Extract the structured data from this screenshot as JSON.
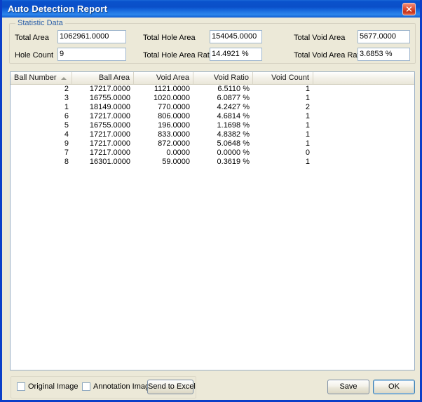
{
  "window": {
    "title": "Auto Detection Report",
    "close_icon": "close-icon",
    "accent_color": "#0A52CC",
    "background_color": "#ECE9D8"
  },
  "statistic_group": {
    "legend": "Statistic Data",
    "fields": [
      {
        "label": "Total Area",
        "value": "1062961.0000"
      },
      {
        "label": "Hole Count",
        "value": "9"
      },
      {
        "label": "Total Hole Area",
        "value": "154045.0000"
      },
      {
        "label": "Total Hole Area Ratio",
        "value": "14.4921 %"
      },
      {
        "label": "Total Void Area",
        "value": "5677.0000"
      },
      {
        "label": "Total Void Area Ratio",
        "value": "3.6853 %"
      }
    ]
  },
  "table": {
    "sort_column": "Ball Number",
    "sort_direction": "ascending",
    "columns": [
      {
        "label": "Ball Number",
        "align": "left",
        "sorted": true
      },
      {
        "label": "Ball Area",
        "align": "right",
        "sorted": false
      },
      {
        "label": "Void Area",
        "align": "right",
        "sorted": false
      },
      {
        "label": "Void Ratio",
        "align": "right",
        "sorted": false
      },
      {
        "label": "Void Count",
        "align": "right",
        "sorted": false
      }
    ],
    "rows": [
      {
        "ball_number": "2",
        "ball_area": "17217.0000",
        "void_area": "1121.0000",
        "void_ratio": "6.5110 %",
        "void_count": "1"
      },
      {
        "ball_number": "3",
        "ball_area": "16755.0000",
        "void_area": "1020.0000",
        "void_ratio": "6.0877 %",
        "void_count": "1"
      },
      {
        "ball_number": "1",
        "ball_area": "18149.0000",
        "void_area": "770.0000",
        "void_ratio": "4.2427 %",
        "void_count": "2"
      },
      {
        "ball_number": "6",
        "ball_area": "17217.0000",
        "void_area": "806.0000",
        "void_ratio": "4.6814 %",
        "void_count": "1"
      },
      {
        "ball_number": "5",
        "ball_area": "16755.0000",
        "void_area": "196.0000",
        "void_ratio": "1.1698 %",
        "void_count": "1"
      },
      {
        "ball_number": "4",
        "ball_area": "17217.0000",
        "void_area": "833.0000",
        "void_ratio": "4.8382 %",
        "void_count": "1"
      },
      {
        "ball_number": "9",
        "ball_area": "17217.0000",
        "void_area": "872.0000",
        "void_ratio": "5.0648 %",
        "void_count": "1"
      },
      {
        "ball_number": "7",
        "ball_area": "17217.0000",
        "void_area": "0.0000",
        "void_ratio": "0.0000 %",
        "void_count": "0"
      },
      {
        "ball_number": "8",
        "ball_area": "16301.0000",
        "void_area": "59.0000",
        "void_ratio": "0.3619 %",
        "void_count": "1"
      }
    ]
  },
  "footer": {
    "checkboxes": [
      {
        "label": "Original Image",
        "checked": false
      },
      {
        "label": "Annotation Image",
        "checked": false
      }
    ],
    "send_to_excel_label": "Send to Excel",
    "save_label": "Save",
    "ok_label": "OK"
  }
}
